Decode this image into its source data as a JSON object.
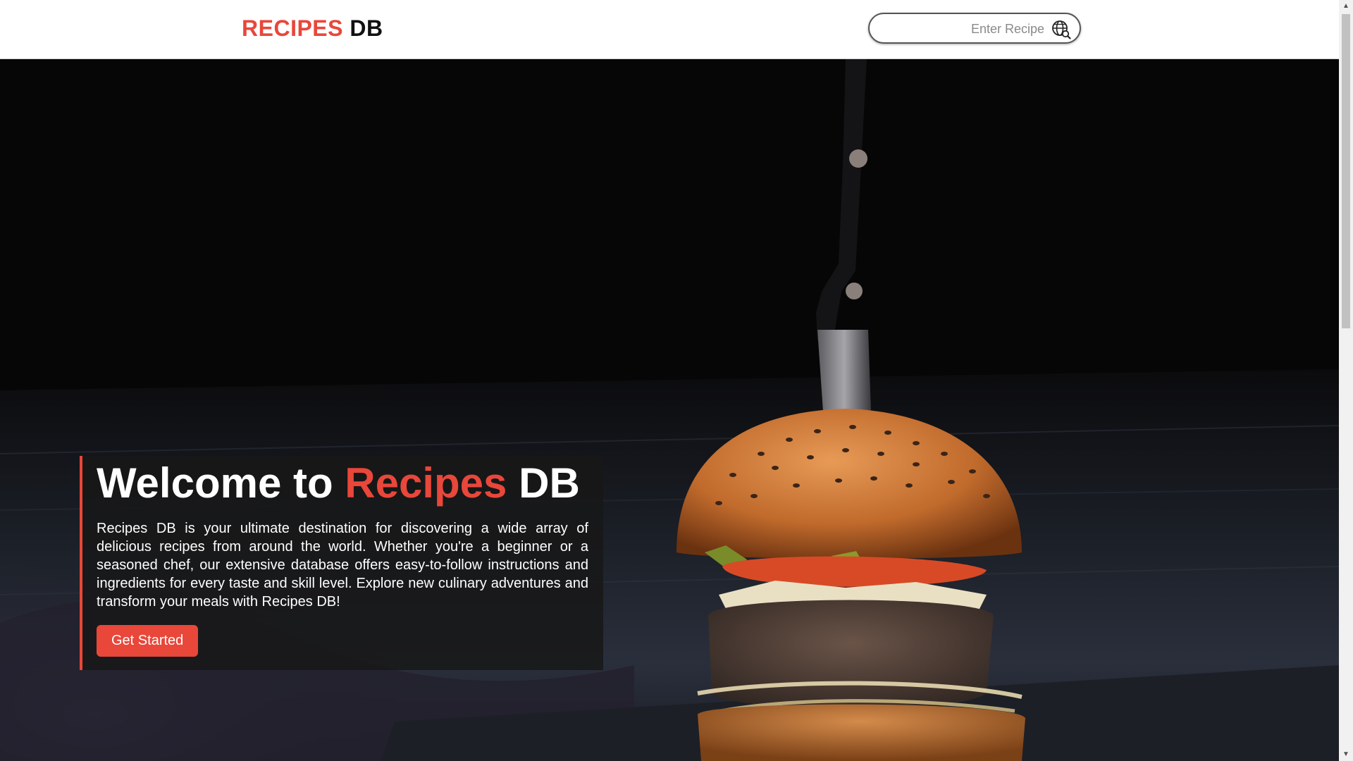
{
  "header": {
    "logo_part1": "RECIPES",
    "logo_part2": "DB",
    "search_placeholder": "Enter Recipe",
    "search_icon": "globe-search-icon"
  },
  "hero": {
    "title_part1": "Welcome to ",
    "title_accent": "Recipes",
    "title_part2": " DB",
    "description": "Recipes DB is your ultimate destination for discovering a wide array of delicious recipes from around the world. Whether you're a beginner or a seasoned chef, our extensive database offers easy-to-follow instructions and ingredients for every taste and skill level. Explore new culinary adventures and transform your meals with Recipes DB!",
    "cta_label": "Get Started",
    "background_image": "burger-with-knife"
  },
  "colors": {
    "accent": "#e8473a",
    "header_bg": "#ffffff",
    "card_bg": "#181818"
  }
}
